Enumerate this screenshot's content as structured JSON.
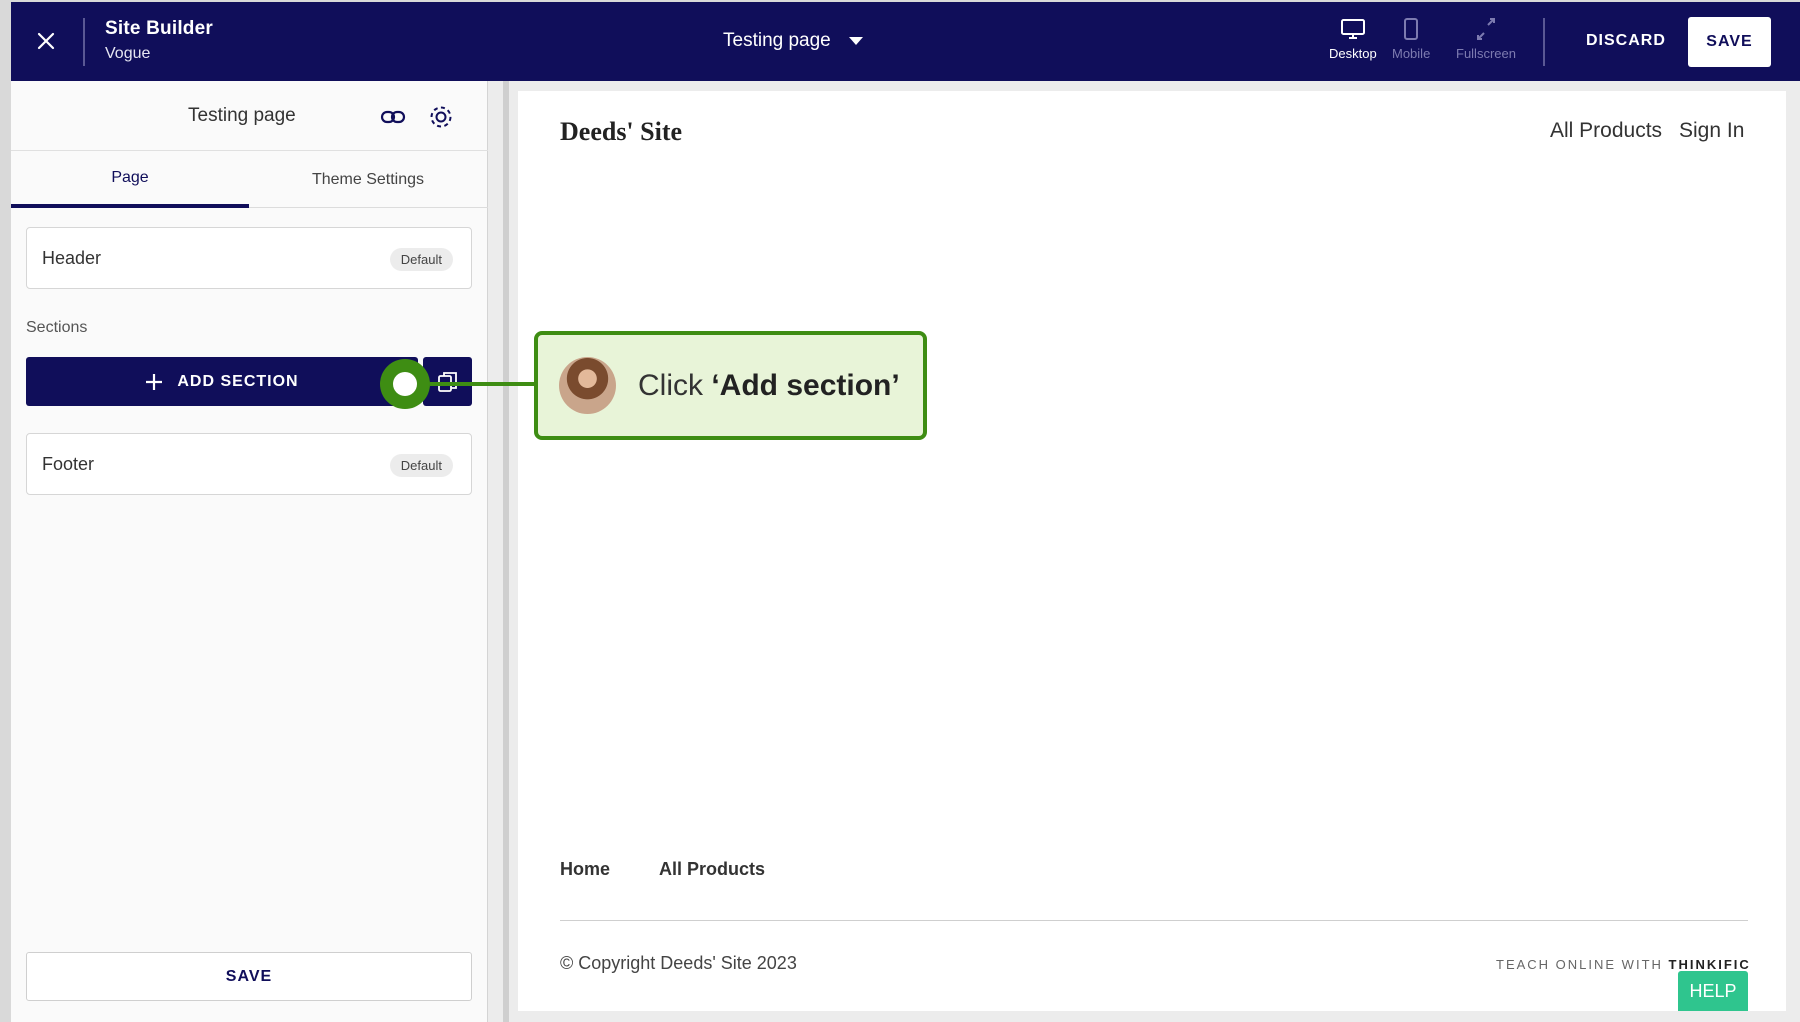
{
  "topbar": {
    "app_title": "Site Builder",
    "theme_name": "Vogue",
    "page_name": "Testing page",
    "views": [
      {
        "label": "Desktop",
        "icon": "desktop-icon",
        "state": "active"
      },
      {
        "label": "Mobile",
        "icon": "mobile-icon",
        "state": "inactive"
      },
      {
        "label": "Fullscreen",
        "icon": "fullscreen-icon",
        "state": "inactive"
      }
    ],
    "discard_label": "DISCARD",
    "save_label": "SAVE"
  },
  "sidebar": {
    "title": "Testing page",
    "tabs": [
      {
        "label": "Page",
        "active": true
      },
      {
        "label": "Theme Settings",
        "active": false
      }
    ],
    "header_card": {
      "label": "Header",
      "badge": "Default"
    },
    "sections_label": "Sections",
    "add_section_label": "ADD SECTION",
    "footer_card": {
      "label": "Footer",
      "badge": "Default"
    },
    "save_label": "SAVE"
  },
  "preview": {
    "site_name": "Deeds' Site",
    "nav": [
      "All Products",
      "Sign In"
    ],
    "footer_nav": [
      "Home",
      "All Products"
    ],
    "copyright": "© Copyright Deeds' Site 2023",
    "teach_prefix": "TEACH ONLINE WITH",
    "teach_brand": "THINKIFIC",
    "help_label": "HELP"
  },
  "tutorial": {
    "prefix": "Click ",
    "emphasis": "‘Add section’"
  },
  "colors": {
    "brand_navy": "#100e5a",
    "tutorial_green": "#3e8d13",
    "help_green": "#2fc58e"
  }
}
